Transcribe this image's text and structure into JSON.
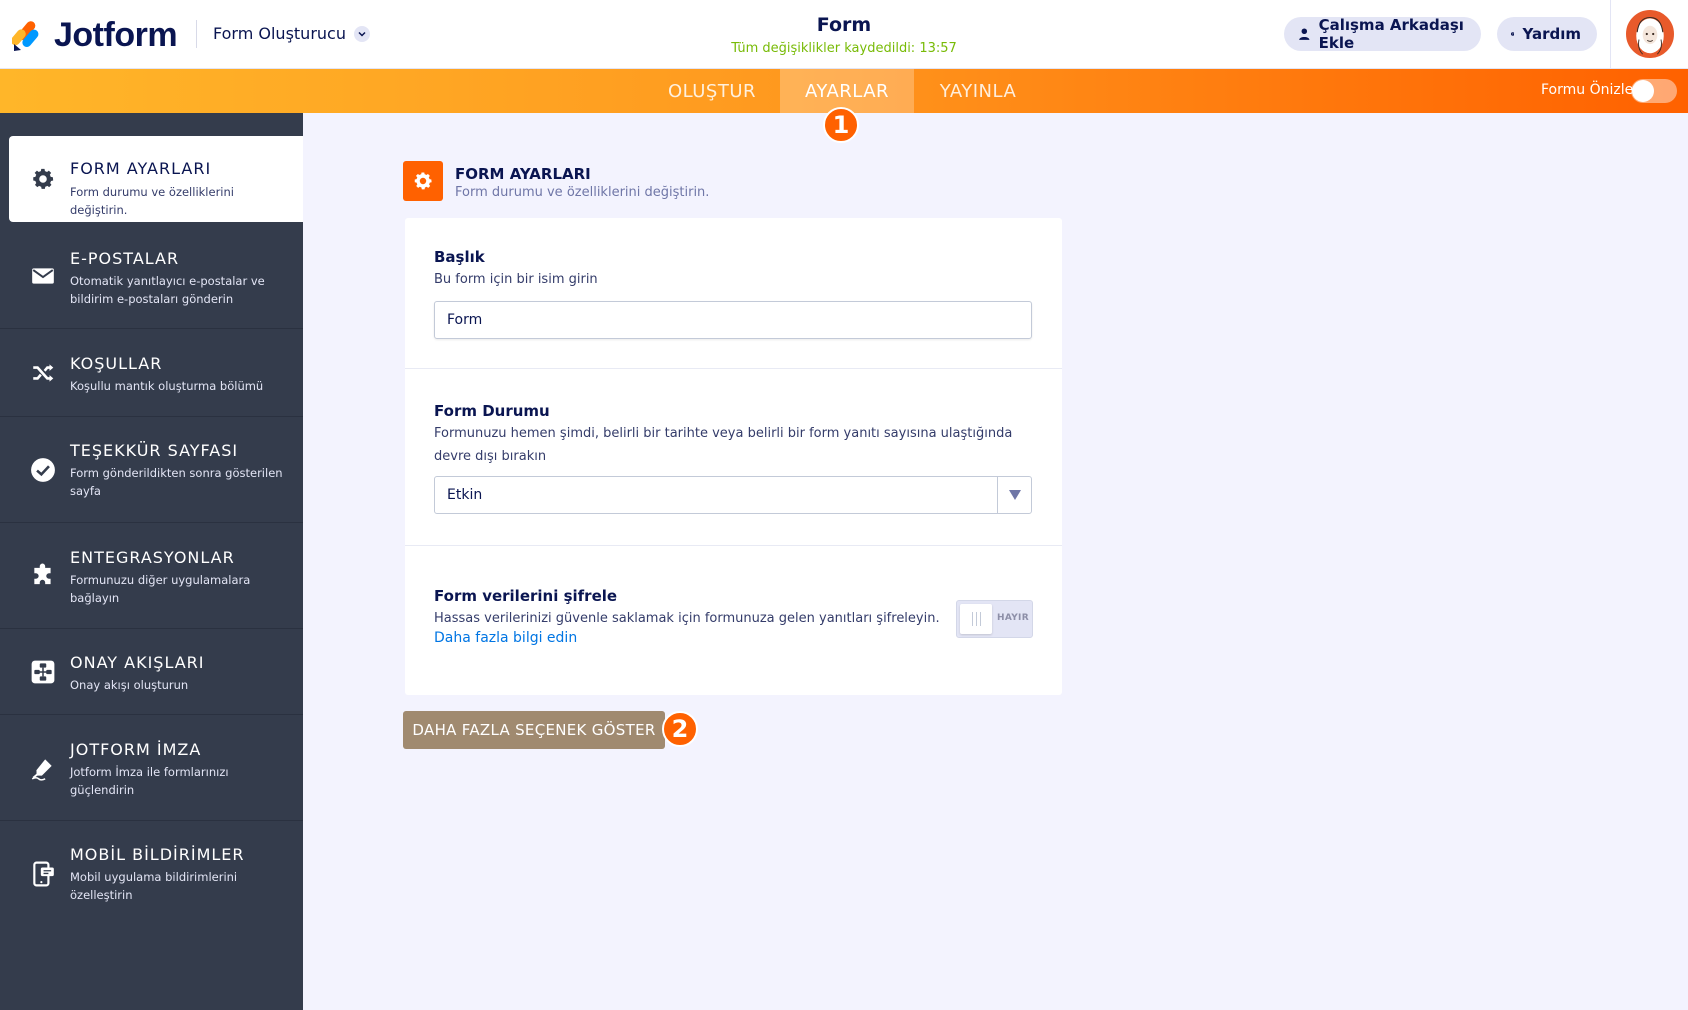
{
  "header": {
    "logo_text": "Jotform",
    "builder_label": "Form Oluşturucu",
    "form_title": "Form",
    "save_status": "Tüm değişiklikler kaydedildi: 13:57",
    "collab_label": "Çalışma Arkadaşı Ekle",
    "help_label": "Yardım"
  },
  "nav": {
    "tabs": [
      {
        "label": "OLUŞTUR"
      },
      {
        "label": "AYARLAR"
      },
      {
        "label": "YAYINLA"
      }
    ],
    "active_tab": "AYARLAR",
    "preview_label": "Formu Önizle"
  },
  "badges": {
    "one": "1",
    "two": "2"
  },
  "sidebar": {
    "items": [
      {
        "title": "FORM AYARLARI",
        "desc": "Form durumu ve özelliklerini değiştirin.",
        "icon": "gear-icon"
      },
      {
        "title": "E-POSTALAR",
        "desc": "Otomatik yanıtlayıcı e-postalar ve bildirim e-postaları gönderin",
        "icon": "envelope-icon"
      },
      {
        "title": "KOŞULLAR",
        "desc": "Koşullu mantık oluşturma bölümü",
        "icon": "shuffle-icon"
      },
      {
        "title": "TEŞEKKÜR SAYFASI",
        "desc": "Form gönderildikten sonra gösterilen sayfa",
        "icon": "check-circle-icon"
      },
      {
        "title": "ENTEGRASYONLAR",
        "desc": "Formunuzu diğer uygulamalara bağlayın",
        "icon": "puzzle-icon"
      },
      {
        "title": "ONAY AKIŞLARI",
        "desc": "Onay akışı oluşturun",
        "icon": "flow-icon"
      },
      {
        "title": "JOTFORM İMZA",
        "desc": "Jotform İmza ile formlarınızı güçlendirin",
        "icon": "pen-icon"
      },
      {
        "title": "MOBİL BİLDİRİMLER",
        "desc": "Mobil uygulama bildirimlerini özelleştirin",
        "icon": "mobile-icon"
      }
    ]
  },
  "main": {
    "section_title": "FORM AYARLARI",
    "section_desc": "Form durumu ve özelliklerini değiştirin.",
    "title_field": {
      "label": "Başlık",
      "help": "Bu form için bir isim girin",
      "value": "Form"
    },
    "status_field": {
      "label": "Form Durumu",
      "help": "Formunuzu hemen şimdi, belirli bir tarihte veya belirli bir form yanıtı sayısına ulaştığında devre dışı bırakın",
      "value": "Etkin"
    },
    "encrypt_field": {
      "label": "Form verilerini şifrele",
      "help": "Hassas verilerinizi güvenle saklamak için formunuza gelen yanıtları şifreleyin.",
      "link": "Daha fazla bilgi edin",
      "toggle_label": "HAYIR"
    },
    "more_button": "DAHA FAZLA SEÇENEK GÖSTER"
  },
  "colors": {
    "accent": "#ff6100",
    "sidebar_bg": "#343c4c",
    "status_green": "#78bb07",
    "more_button_bg": "#a08a70",
    "link_blue": "#0075e3"
  }
}
